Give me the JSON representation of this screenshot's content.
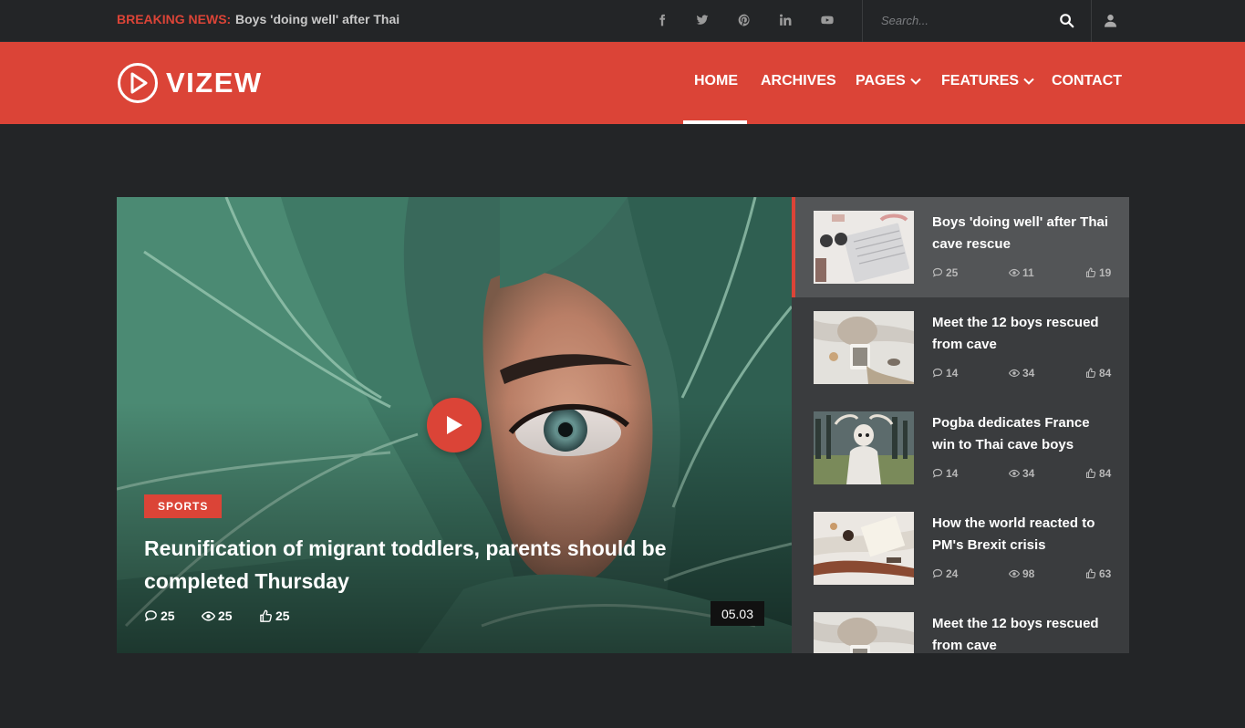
{
  "topbar": {
    "breaking_label": "BREAKING NEWS:",
    "breaking_text": "Boys 'doing well' after Thai",
    "social_icons": [
      "facebook-icon",
      "twitter-icon",
      "pinterest-icon",
      "linkedin-icon",
      "youtube-icon"
    ],
    "search_placeholder": "Search..."
  },
  "header": {
    "logo_text": "VIZEW",
    "nav": [
      {
        "label": "HOME",
        "active": true,
        "has_dropdown": false
      },
      {
        "label": "ARCHIVES",
        "active": false,
        "has_dropdown": false
      },
      {
        "label": "PAGES",
        "active": false,
        "has_dropdown": true
      },
      {
        "label": "FEATURES",
        "active": false,
        "has_dropdown": true
      },
      {
        "label": "CONTACT",
        "active": false,
        "has_dropdown": false
      }
    ]
  },
  "featured": {
    "category": "SPORTS",
    "title": "Reunification of migrant toddlers, parents should be completed Thursday",
    "comments": "25",
    "views": "25",
    "likes": "25",
    "duration": "05.03"
  },
  "playlist": [
    {
      "title": "Boys 'doing well' after Thai cave rescue",
      "comments": "25",
      "views": "11",
      "likes": "19",
      "active": true
    },
    {
      "title": "Meet the 12 boys rescued from cave",
      "comments": "14",
      "views": "34",
      "likes": "84",
      "active": false
    },
    {
      "title": "Pogba dedicates France win to Thai cave boys",
      "comments": "14",
      "views": "34",
      "likes": "84",
      "active": false
    },
    {
      "title": "How the world reacted to PM's Brexit crisis",
      "comments": "24",
      "views": "98",
      "likes": "63",
      "active": false
    },
    {
      "title": "Meet the 12 boys rescued from cave",
      "comments": "",
      "views": "",
      "likes": "",
      "active": false
    }
  ],
  "colors": {
    "accent": "#db4437",
    "background": "#232527",
    "playlist_bg": "#3a3c3e",
    "playlist_active": "#535557"
  }
}
